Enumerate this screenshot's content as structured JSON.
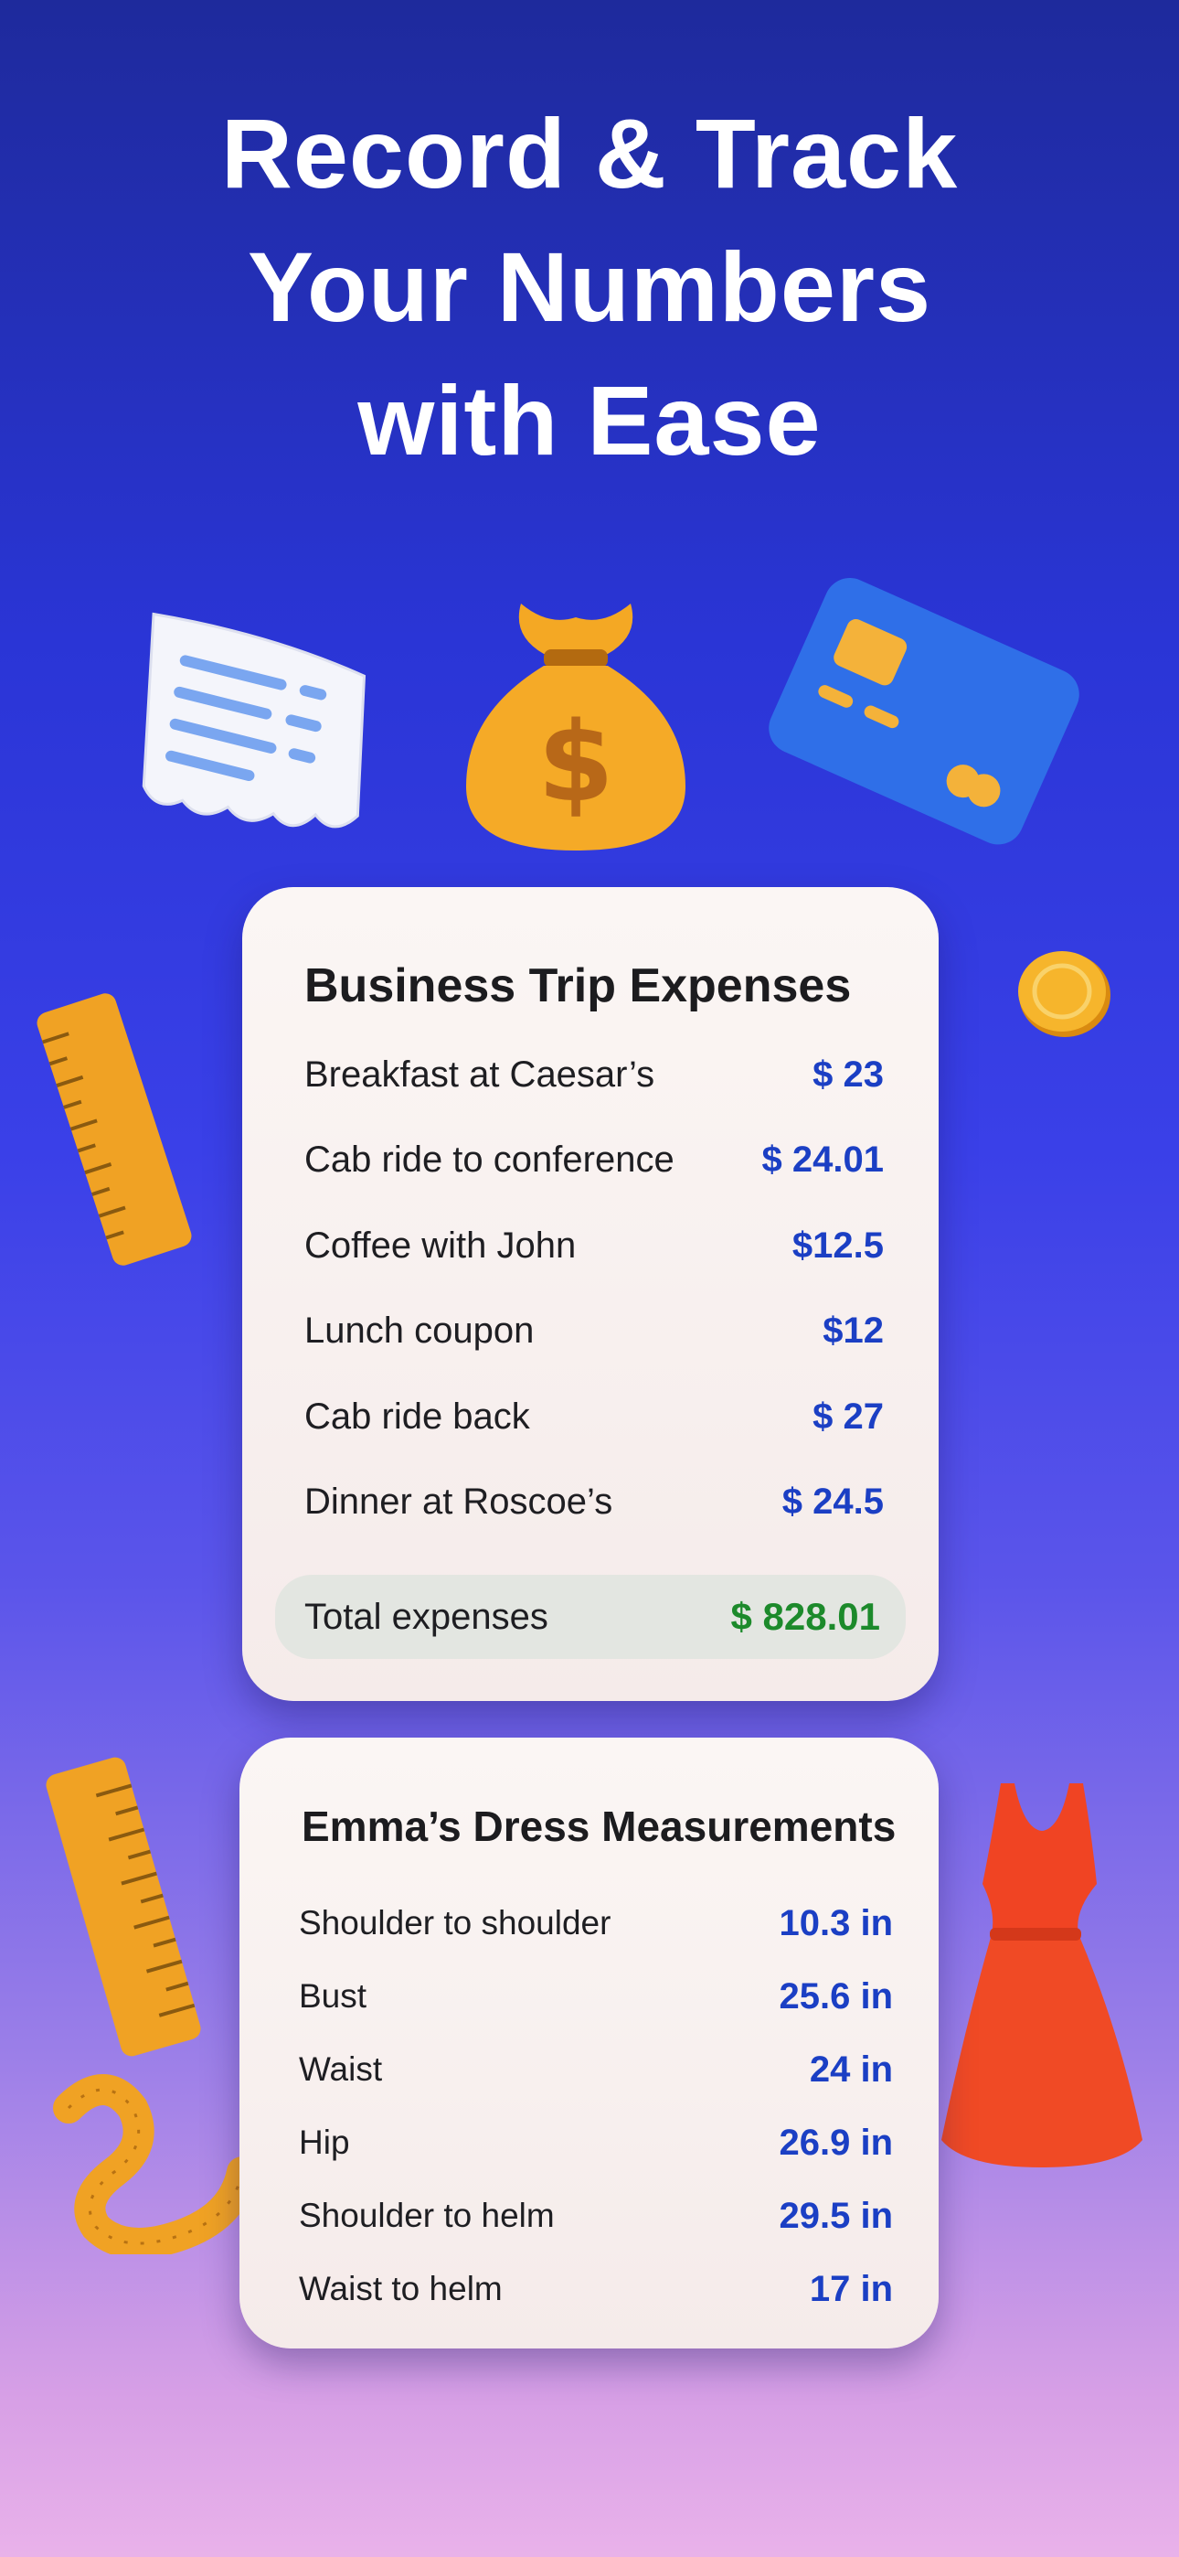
{
  "headline": {
    "line1": "Record & Track",
    "line2": "Your Numbers",
    "line3": "with Ease"
  },
  "expenses": {
    "title": "Business Trip Expenses",
    "items": [
      {
        "label": "Breakfast at Caesar’s",
        "value": "$ 23"
      },
      {
        "label": "Cab ride to conference",
        "value": "$ 24.01"
      },
      {
        "label": "Coffee with John",
        "value": "$12.5"
      },
      {
        "label": "Lunch coupon",
        "value": "$12"
      },
      {
        "label": "Cab ride back",
        "value": "$ 27"
      },
      {
        "label": "Dinner at Roscoe’s",
        "value": "$ 24.5"
      }
    ],
    "total": {
      "label": "Total expenses",
      "value": "$ 828.01"
    }
  },
  "measurements": {
    "title": "Emma’s Dress Measurements",
    "items": [
      {
        "label": "Shoulder to shoulder",
        "value": "10.3  in"
      },
      {
        "label": "Bust",
        "value": "25.6  in"
      },
      {
        "label": "Waist",
        "value": "24  in"
      },
      {
        "label": "Hip",
        "value": "26.9  in"
      },
      {
        "label": "Shoulder to helm",
        "value": "29.5  in"
      },
      {
        "label": "Waist to helm",
        "value": "17  in"
      }
    ]
  },
  "decorations": {
    "receipt": "receipt-icon",
    "money_bag": "money-bag-icon",
    "credit_card": "credit-card-icon",
    "coin": "coin-icon",
    "ruler": "ruler-icon",
    "tape": "measuring-tape-icon",
    "dress": "dress-icon"
  },
  "colors": {
    "value_blue": "#1b3fc4",
    "total_green": "#1c8a2b",
    "accent_orange": "#f2a11c",
    "card_blue": "#2f6fe8",
    "dress_red": "#f04423"
  }
}
